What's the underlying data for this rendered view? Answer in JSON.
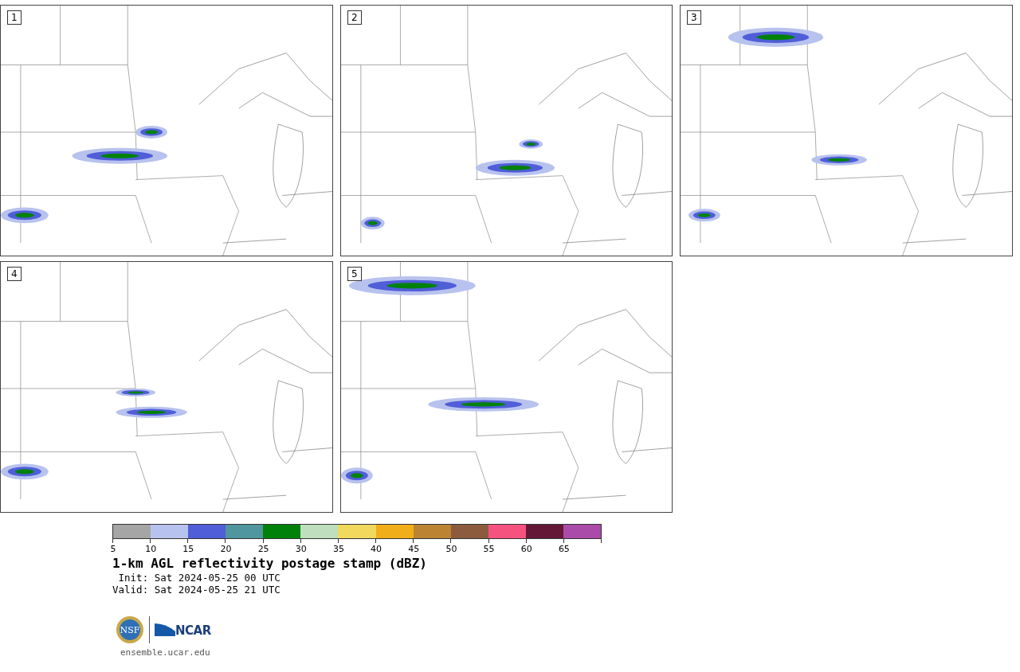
{
  "stamps": [
    {
      "label": "1"
    },
    {
      "label": "2"
    },
    {
      "label": "3"
    },
    {
      "label": "4"
    },
    {
      "label": "5"
    }
  ],
  "colorbar": {
    "bins": [
      {
        "label": "5",
        "color": "#a5a5a5"
      },
      {
        "label": "10",
        "color": "#b8c2ee"
      },
      {
        "label": "15",
        "color": "#505ed8"
      },
      {
        "label": "20",
        "color": "#4f969e"
      },
      {
        "label": "25",
        "color": "#00820a"
      },
      {
        "label": "30",
        "color": "#bedebd"
      },
      {
        "label": "35",
        "color": "#f0d95c"
      },
      {
        "label": "40",
        "color": "#f0ae1a"
      },
      {
        "label": "45",
        "color": "#bb8332"
      },
      {
        "label": "50",
        "color": "#8c5b3e"
      },
      {
        "label": "55",
        "color": "#f65280"
      },
      {
        "label": "60",
        "color": "#641737"
      },
      {
        "label": "65",
        "color": "#ab4ba9"
      }
    ]
  },
  "title": "1-km AGL reflectivity postage stamp (dBZ)",
  "init": " Init: Sat 2024-05-25 00 UTC",
  "valid": "Valid: Sat 2024-05-25 21 UTC",
  "logos": {
    "seal": "NSF",
    "wordmark": "NCAR"
  },
  "footer": "ensemble.ucar.edu"
}
